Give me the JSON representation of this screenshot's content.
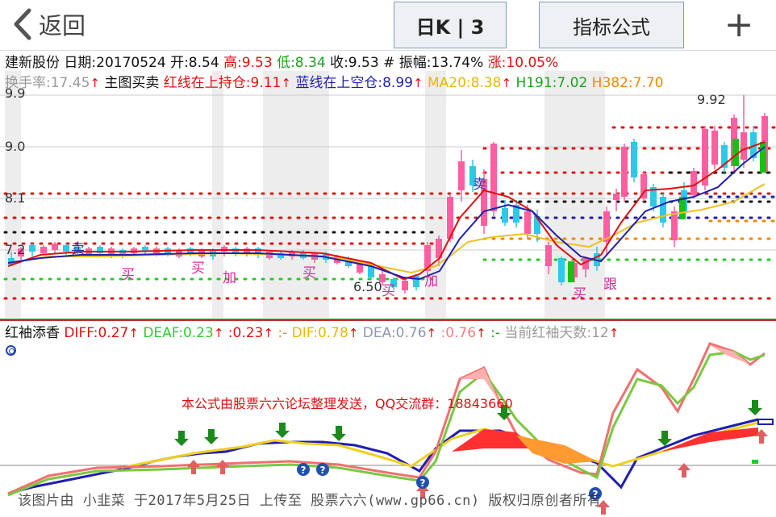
{
  "topbar": {
    "back_label": "返回",
    "kline_button": "日K | 3",
    "formula_button": "指标公式",
    "plus_symbol": "+"
  },
  "info": {
    "stock_name": "建新股份",
    "date": "日期:20170524",
    "open": "开:8.54",
    "high": "高:9.53",
    "low": "低:8.34",
    "close": "收:9.53",
    "amplitude": "# 振幅:13.74%",
    "change": "涨:10.05%"
  },
  "main_indicators": {
    "turnover": "换手率:17.45",
    "title": "主图买卖",
    "red_line": "红线在上持仓:9.11",
    "blue_line": "蓝线在上空仓:8.99",
    "ma20": "MA20:8.38",
    "h191": "H191:7.02",
    "h382": "H382:7.70"
  },
  "y_axis": [
    "9.9",
    "9.0",
    "8.1",
    "7.2"
  ],
  "price_annotations": {
    "high": "9.92",
    "low": "6.50"
  },
  "signals": {
    "sell1": "卖",
    "sell2": "卖",
    "buy": "买",
    "add": "加",
    "follow": "跟"
  },
  "sub_indicators": {
    "title": "红袖添香",
    "diff": "DIFF:0.27",
    "deaf": "DEAF:0.23",
    "blank1": ":0.23",
    "dash1": ":-",
    "dif": "DIF:0.78",
    "dea": "DEA:0.76",
    "blank2": ":0.76",
    "dash2": ":-",
    "days": "当前红袖天数:12"
  },
  "notice": "本公式由股票六六论坛整理发送，QQ交流群：18843660",
  "watermark": "该图片由 小韭菜 于2017年5月25日 上传至 股票六六(www.gp66.cn) 版权归原创者所有",
  "colors": {
    "up": "#ff5fa0",
    "down": "#2ec8e8",
    "red_line": "#e01010",
    "blue_line": "#1f1fb0",
    "ma20": "#f0c020",
    "accent_btn_border": "#7f9bbf"
  }
}
